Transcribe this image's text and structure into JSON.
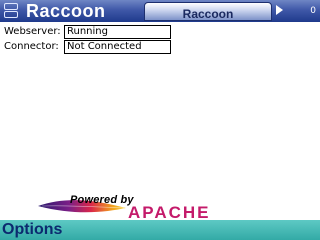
{
  "titlebar": {
    "app_title": "Raccoon",
    "tab_label": "Raccoon",
    "battery_value": "0",
    "app_icon": "app-grid-icon"
  },
  "status": {
    "webserver_label": "Webserver:",
    "webserver_value": "Running",
    "connector_label": "Connector:",
    "connector_value": "Not Connected"
  },
  "logo": {
    "powered_by": "Powered by",
    "apache": "APACHE"
  },
  "softkeys": {
    "left": "Options"
  },
  "colors": {
    "titlebar": "#2a4696",
    "softkeys": "#3cb6b1",
    "softkey_text": "#0b2a6f",
    "apache_red": "#c41a6a"
  }
}
